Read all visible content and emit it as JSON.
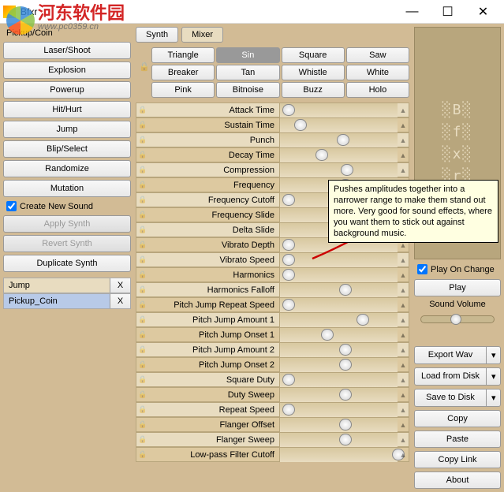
{
  "window": {
    "title": "Bfxr"
  },
  "watermark": {
    "text": "河东软件园",
    "url": "www.pc0359.cn"
  },
  "left": {
    "preset_label": "Pickup/Coin",
    "presets": [
      "Laser/Shoot",
      "Explosion",
      "Powerup",
      "Hit/Hurt",
      "Jump",
      "Blip/Select",
      "Randomize",
      "Mutation"
    ],
    "create_new": "Create New Sound",
    "apply": "Apply Synth",
    "revert": "Revert Synth",
    "duplicate": "Duplicate Synth",
    "items": [
      {
        "name": "Jump",
        "selected": false
      },
      {
        "name": "Pickup_Coin",
        "selected": true
      }
    ]
  },
  "tabs": {
    "synth": "Synth",
    "mixer": "Mixer"
  },
  "waves": {
    "r1": [
      "Triangle",
      "Sin",
      "Square",
      "Saw"
    ],
    "r2": [
      "Breaker",
      "Tan",
      "Whistle",
      "White"
    ],
    "r3": [
      "Pink",
      "Bitnoise",
      "Buzz",
      "Holo"
    ],
    "active": "Sin"
  },
  "params": [
    {
      "label": "Attack Time",
      "pos": 2
    },
    {
      "label": "Sustain Time",
      "pos": 12
    },
    {
      "label": "Punch",
      "pos": 48
    },
    {
      "label": "Decay Time",
      "pos": 30
    },
    {
      "label": "Compression",
      "pos": 52
    },
    {
      "label": "Frequency",
      "pos": 50
    },
    {
      "label": "Frequency Cutoff",
      "pos": 2
    },
    {
      "label": "Frequency Slide",
      "pos": 50
    },
    {
      "label": "Delta Slide",
      "pos": 50
    },
    {
      "label": "Vibrato Depth",
      "pos": 2
    },
    {
      "label": "Vibrato Speed",
      "pos": 2
    },
    {
      "label": "Harmonics",
      "pos": 2
    },
    {
      "label": "Harmonics Falloff",
      "pos": 50
    },
    {
      "label": "Pitch Jump Repeat Speed",
      "pos": 2
    },
    {
      "label": "Pitch Jump Amount 1",
      "pos": 65
    },
    {
      "label": "Pitch Jump Onset 1",
      "pos": 35
    },
    {
      "label": "Pitch Jump Amount 2",
      "pos": 50
    },
    {
      "label": "Pitch Jump Onset 2",
      "pos": 50
    },
    {
      "label": "Square Duty",
      "pos": 2
    },
    {
      "label": "Duty Sweep",
      "pos": 50
    },
    {
      "label": "Repeat Speed",
      "pos": 2
    },
    {
      "label": "Flanger Offset",
      "pos": 50
    },
    {
      "label": "Flanger Sweep",
      "pos": 50
    },
    {
      "label": "Low-pass Filter Cutoff",
      "pos": 95
    }
  ],
  "right": {
    "play_on_change": "Play On Change",
    "play": "Play",
    "sound_volume": "Sound Volume",
    "export": "Export Wav",
    "load": "Load from Disk",
    "save": "Save to Disk",
    "copy": "Copy",
    "paste": "Paste",
    "copylink": "Copy Link",
    "about": "About"
  },
  "tooltip": "Pushes amplitudes together into a narrower range to make them stand out more.  Very good for sound effects, where you want them to stick out against background music."
}
